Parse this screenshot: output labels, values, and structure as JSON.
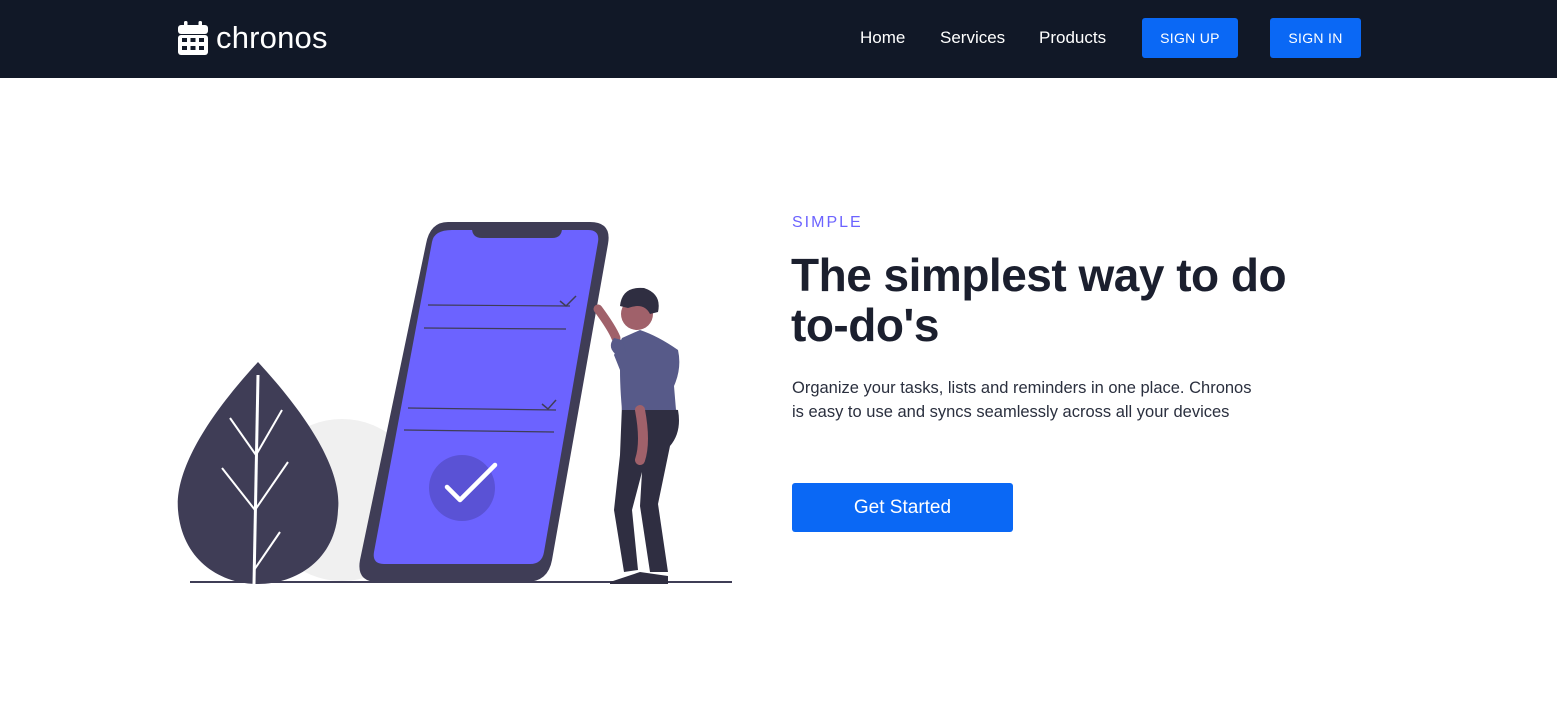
{
  "brand": {
    "name": "chronos",
    "icon": "calendar-icon"
  },
  "nav": {
    "links": [
      "Home",
      "Services",
      "Products"
    ],
    "sign_up": "SIGN UP",
    "sign_in": "SIGN IN"
  },
  "hero": {
    "eyebrow": "SIMPLE",
    "title": "The simplest way to do to-do's",
    "description": "Organize your tasks, lists and reminders in one place. Chronos is easy to use and syncs seamlessly across all your devices",
    "cta": "Get Started"
  },
  "colors": {
    "navbar_bg": "#111827",
    "primary_button": "#0a68f5",
    "accent_purple": "#6c63ff",
    "dark_figure": "#3f3d56"
  }
}
